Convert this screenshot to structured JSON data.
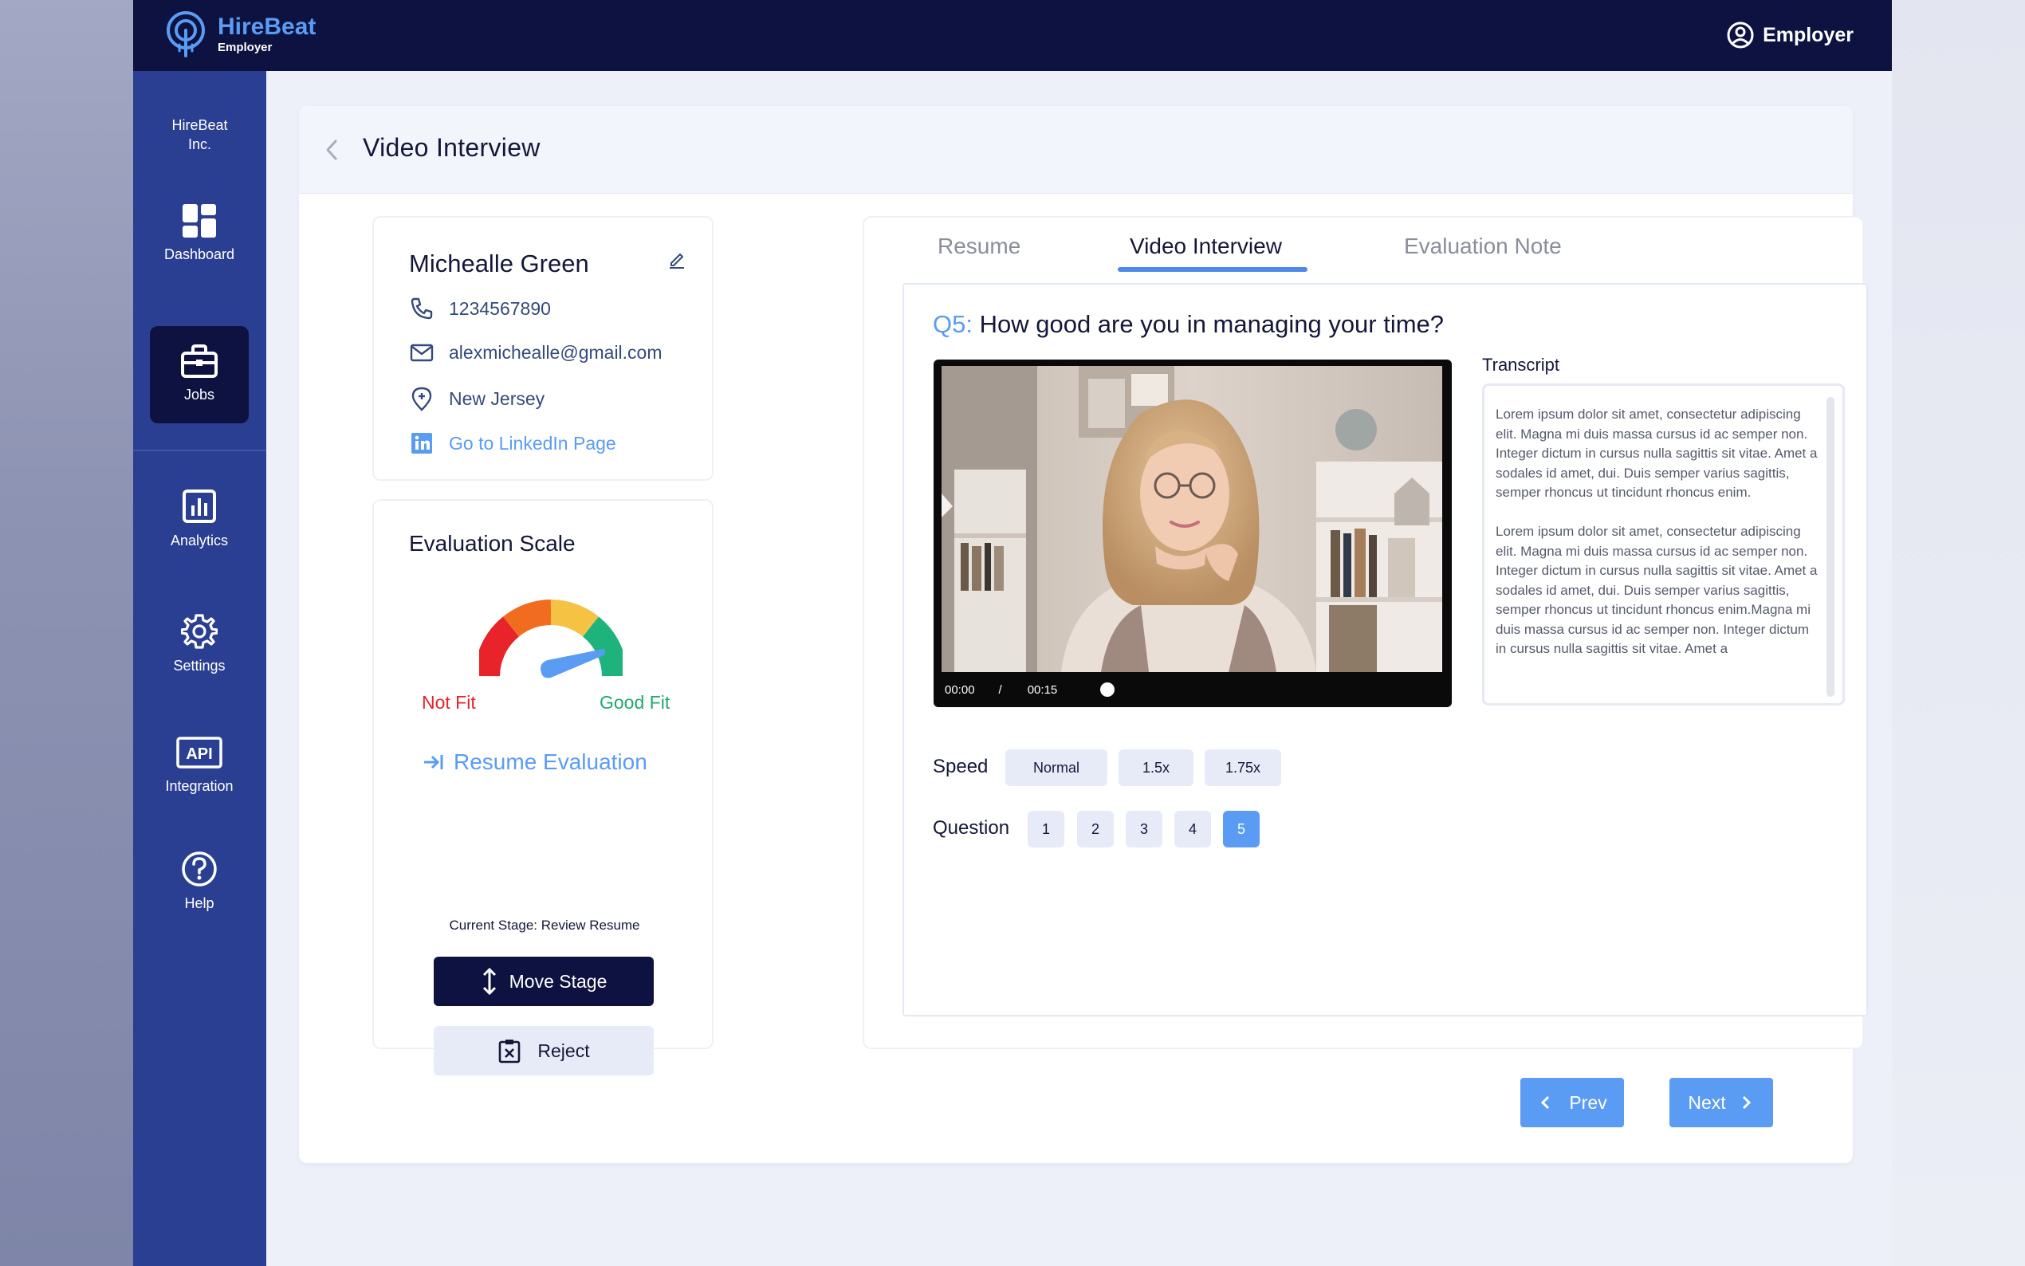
{
  "app": {
    "brand": "HireBeat",
    "brand_sub": "Employer",
    "user_label": "Employer"
  },
  "sidebar": {
    "company": "HireBeat Inc.",
    "items": [
      {
        "label": "Dashboard",
        "icon": "grid-icon"
      },
      {
        "label": "Jobs",
        "icon": "briefcase-icon",
        "active": true
      },
      {
        "label": "Analytics",
        "icon": "bar-chart-icon"
      },
      {
        "label": "Settings",
        "icon": "gear-icon"
      },
      {
        "label": "Integration",
        "icon": "api-icon"
      },
      {
        "label": "Help",
        "icon": "question-icon"
      }
    ]
  },
  "page": {
    "title": "Video Interview"
  },
  "candidate": {
    "name": "Michealle Green",
    "phone": "1234567890",
    "email": "alexmichealle@gmail.com",
    "location": "New Jersey",
    "linkedin_label": "Go to LinkedIn Page"
  },
  "evaluation": {
    "title": "Evaluation Scale",
    "low_label": "Not Fit",
    "high_label": "Good Fit",
    "resume_eval_label": "Resume Evaluation",
    "stage_text": "Current Stage: Review Resume",
    "move_label": "Move Stage",
    "reject_label": "Reject",
    "colors": {
      "red": "#e8232a",
      "orange": "#f26c1f",
      "yellow": "#f6c244",
      "green": "#1eb37c",
      "needle": "#5a9cf4"
    }
  },
  "tabs": [
    {
      "label": "Resume",
      "active": false
    },
    {
      "label": "Video Interview",
      "active": true
    },
    {
      "label": "Evaluation Note",
      "active": false
    }
  ],
  "question": {
    "number_label": "Q5:",
    "text": "How good are you in managing your time?"
  },
  "video": {
    "current_time": "00:00",
    "separator": "/",
    "duration": "00:15"
  },
  "transcript": {
    "label": "Transcript",
    "paragraphs": [
      "Lorem ipsum dolor sit amet, consectetur adipiscing elit. Magna mi duis massa cursus id ac semper non. Integer dictum in cursus nulla sagittis sit vitae. Amet a sodales id amet, dui. Duis semper varius sagittis, semper rhoncus ut tincidunt rhoncus enim.",
      "Lorem ipsum dolor sit amet, consectetur adipiscing elit. Magna mi duis massa cursus id ac semper non. Integer dictum in cursus nulla sagittis sit vitae. Amet a sodales id amet, dui. Duis semper varius sagittis, semper rhoncus ut tincidunt rhoncus enim.Magna mi duis massa cursus id ac semper non. Integer dictum in cursus nulla sagittis sit vitae. Amet a"
    ]
  },
  "speed": {
    "label": "Speed",
    "options": [
      "Normal",
      "1.5x",
      "1.75x"
    ]
  },
  "questions": {
    "label": "Question",
    "options": [
      "1",
      "2",
      "3",
      "4",
      "5"
    ],
    "active": "5"
  },
  "pagination": {
    "prev_label": "Prev",
    "next_label": "Next"
  },
  "colors": {
    "navy": "#0d1240",
    "sidebar": "#2b3f92",
    "accent": "#5a9cf4"
  }
}
